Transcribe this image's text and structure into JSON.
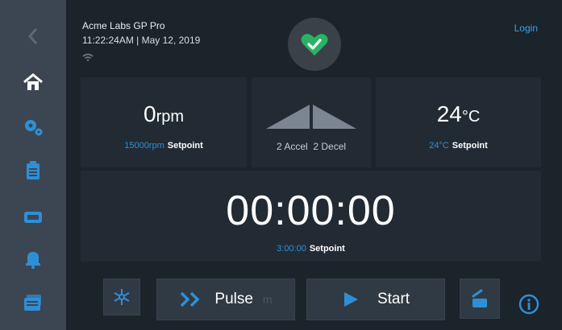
{
  "header": {
    "title": "Acme Labs GP Pro",
    "datetime": "11:22:24AM | May 12, 2019",
    "login_label": "Login"
  },
  "sidebar": {
    "items": [
      {
        "icon": "back-arrow-icon"
      },
      {
        "icon": "home-icon"
      },
      {
        "icon": "settings-gears-icon"
      },
      {
        "icon": "clipboard-icon"
      },
      {
        "icon": "display-icon"
      },
      {
        "icon": "bell-icon"
      },
      {
        "icon": "programs-stack-icon"
      }
    ]
  },
  "speed": {
    "value": "0",
    "unit": "rpm",
    "setpoint_value": "15000rpm",
    "setpoint_label": "Setpoint"
  },
  "accel": {
    "accel_label": "2 Accel",
    "decel_label": "2 Decel"
  },
  "temperature": {
    "value": "24",
    "unit": "°C",
    "setpoint_value": "24°C",
    "setpoint_label": "Setpoint"
  },
  "timer": {
    "value": "00:00:00",
    "setpoint_value": "3:00:00",
    "setpoint_label": "Setpoint"
  },
  "controls": {
    "pulse_label": "Pulse",
    "pulse_hint": "m",
    "start_label": "Start"
  },
  "colors": {
    "accent_blue": "#2f8fd6",
    "status_green": "#28b463",
    "sidebar_bg": "#3b4652",
    "panel_bg": "#222b34"
  }
}
